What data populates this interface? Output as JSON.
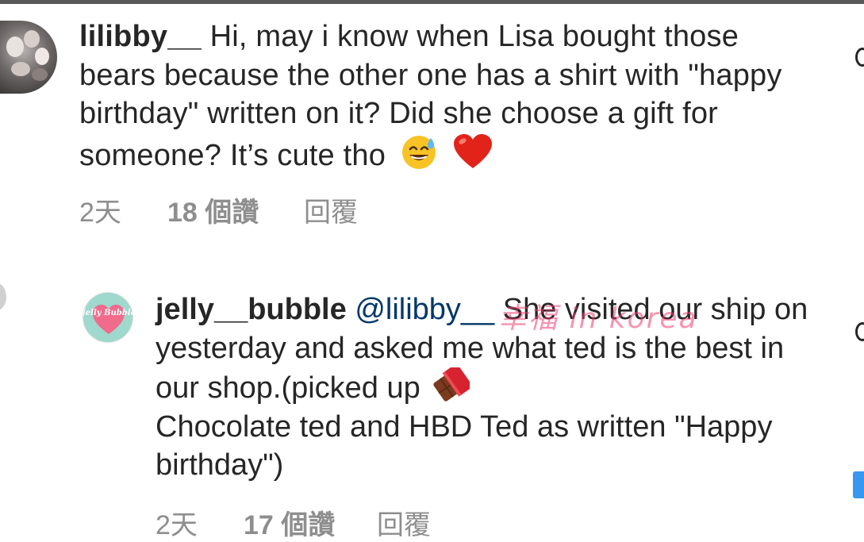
{
  "comments": [
    {
      "username": "lilibby__",
      "text": "Hi, may i know when Lisa bought those bears because the other one has a shirt with \"happy birthday\" written on it? Did she choose a gift for someone? It’s cute tho",
      "emojis": [
        "sweat-smile-icon",
        "red-heart-icon"
      ],
      "time": "2天",
      "likes": "18 個讚",
      "reply": "回覆"
    },
    {
      "username": "jelly__bubble",
      "mention": "@lilibby__",
      "text_before_emoji": "She visited our ship on yesterday and asked me what ted is the best in our shop.(picked up",
      "text_after_emoji": "Chocolate ted and HBD Ted as written \"Happy birthday\")",
      "emoji": "chocolate-bar-icon",
      "avatar_text": "Jelly Bubble",
      "time": "2天",
      "likes": "17 個讚",
      "reply": "回覆"
    }
  ],
  "watermark": "幸福 in korea",
  "colors": {
    "text": "#262626",
    "meta": "#8e8e8e",
    "mention": "#00376b",
    "accent": "#3897f0"
  }
}
